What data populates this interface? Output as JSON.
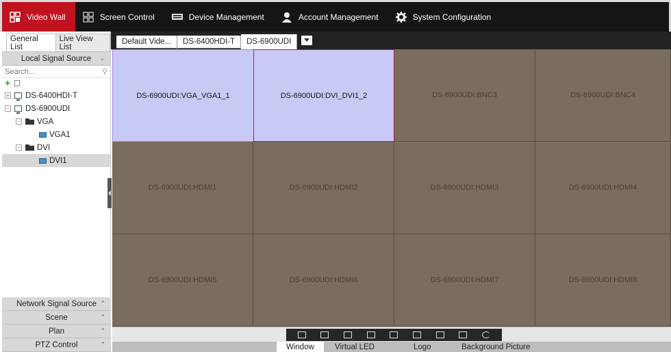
{
  "nav": {
    "items": [
      {
        "label": "Video Wall",
        "icon": "video-wall-icon"
      },
      {
        "label": "Screen Control",
        "icon": "screen-control-icon"
      },
      {
        "label": "Device Management",
        "icon": "device-icon"
      },
      {
        "label": "Account Management",
        "icon": "user-icon"
      },
      {
        "label": "System Configuration",
        "icon": "gear-icon"
      }
    ],
    "active_color": "#c1121f"
  },
  "left": {
    "tabs": [
      "General List",
      "Live View List"
    ],
    "local_source_label": "Local Signal Source",
    "search_placeholder": "Search...",
    "tree": [
      {
        "label": "DS-6400HDI-T"
      },
      {
        "label": "DS-6900UDI"
      },
      {
        "label": "VGA"
      },
      {
        "label": "VGA1"
      },
      {
        "label": "DVI"
      },
      {
        "label": "DVI1"
      }
    ],
    "bottom_sections": [
      "Network Signal Source",
      "Scene",
      "Plan",
      "PTZ Control"
    ]
  },
  "wall": {
    "tabs": [
      "Default Vide...",
      "DS-6400HDI-T",
      "DS-6900UDI"
    ],
    "cells": [
      "DS-6900UDI:VGA_VGA1_1",
      "DS-6900UDI:DVI_DVI1_2",
      "DS-6900UDI:BNC3",
      "DS-6900UDI:BNC4",
      "DS-6900UDI:HDMI1",
      "DS-6900UDI:HDMI2",
      "DS-6900UDI:HDMI3",
      "DS-6900UDI:HDMI4",
      "DS-6900UDI:HDMI5",
      "DS-6900UDI:HDMI6",
      "DS-6900UDI:HDMI7",
      "DS-6900UDI:HDMI8"
    ]
  },
  "modes": [
    "Window",
    "Virtual LED",
    "Logo",
    "Background Picture"
  ]
}
